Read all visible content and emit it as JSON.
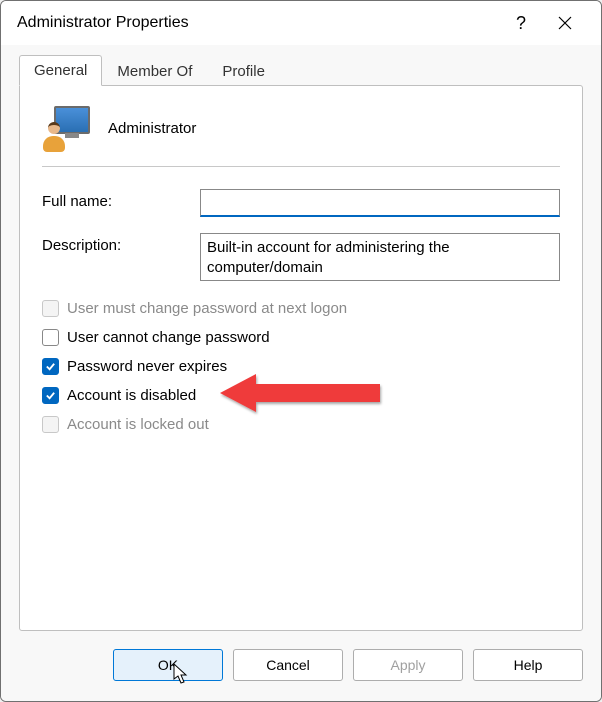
{
  "window": {
    "title": "Administrator Properties"
  },
  "tabs": {
    "general": "General",
    "memberOf": "Member Of",
    "profile": "Profile"
  },
  "user": {
    "name": "Administrator"
  },
  "fields": {
    "fullNameLabel": "Full name:",
    "fullNameValue": "",
    "descriptionLabel": "Description:",
    "descriptionValue": "Built-in account for administering the computer/domain"
  },
  "checkboxes": {
    "mustChange": {
      "label": "User must change password at next logon",
      "checked": false,
      "disabled": true
    },
    "cannotChange": {
      "label": "User cannot change password",
      "checked": false,
      "disabled": false
    },
    "neverExpires": {
      "label": "Password never expires",
      "checked": true,
      "disabled": false
    },
    "isDisabled": {
      "label": "Account is disabled",
      "checked": true,
      "disabled": false
    },
    "lockedOut": {
      "label": "Account is locked out",
      "checked": false,
      "disabled": true
    }
  },
  "buttons": {
    "ok": "OK",
    "cancel": "Cancel",
    "apply": "Apply",
    "help": "Help"
  }
}
